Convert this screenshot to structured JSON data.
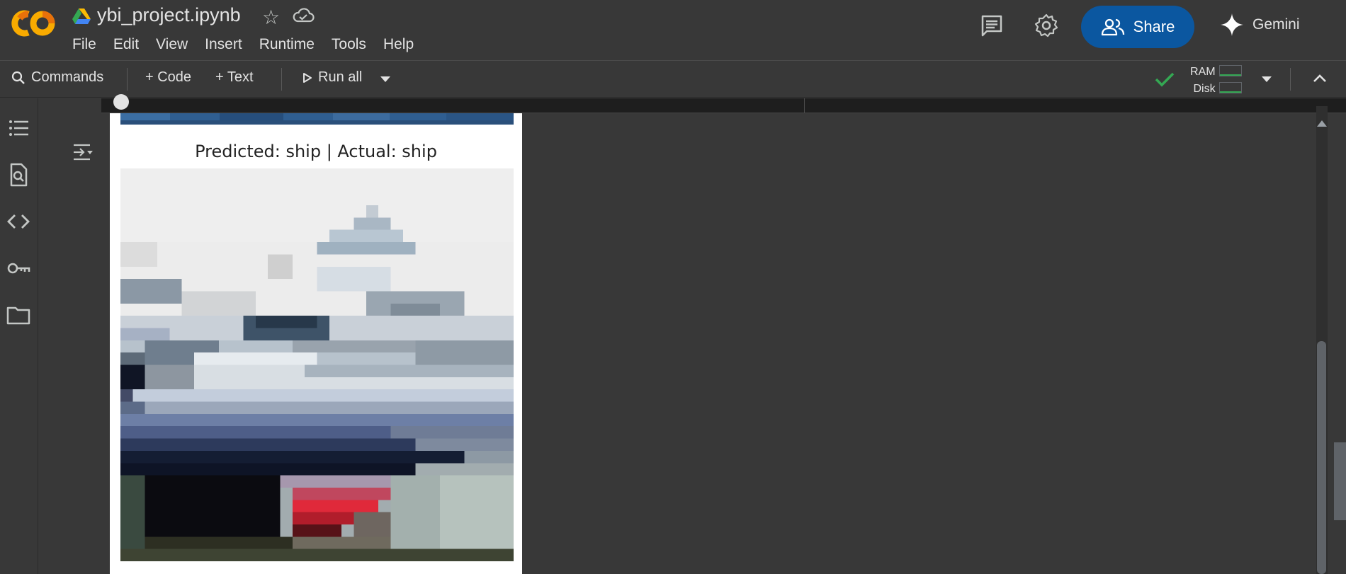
{
  "header": {
    "filename": "ybi_project.ipynb",
    "menu": [
      "File",
      "Edit",
      "View",
      "Insert",
      "Runtime",
      "Tools",
      "Help"
    ],
    "share_label": "Share",
    "gemini_label": "Gemini",
    "logo_text": "CO",
    "colors": {
      "share_bg": "#0b57a0",
      "logo_orange": "#f9ab00"
    }
  },
  "toolbar": {
    "commands_label": "Commands",
    "code_label": "+ Code",
    "text_label": "+ Text",
    "run_all_label": "Run all",
    "ram_label": "RAM",
    "disk_label": "Disk",
    "status_color": "#34a853"
  },
  "sidebar": {
    "items": [
      "table-of-contents-icon",
      "find-icon",
      "code-snippets-icon",
      "secrets-key-icon",
      "files-folder-icon"
    ]
  },
  "output": {
    "prediction_title": "Predicted: ship | Actual: ship"
  }
}
